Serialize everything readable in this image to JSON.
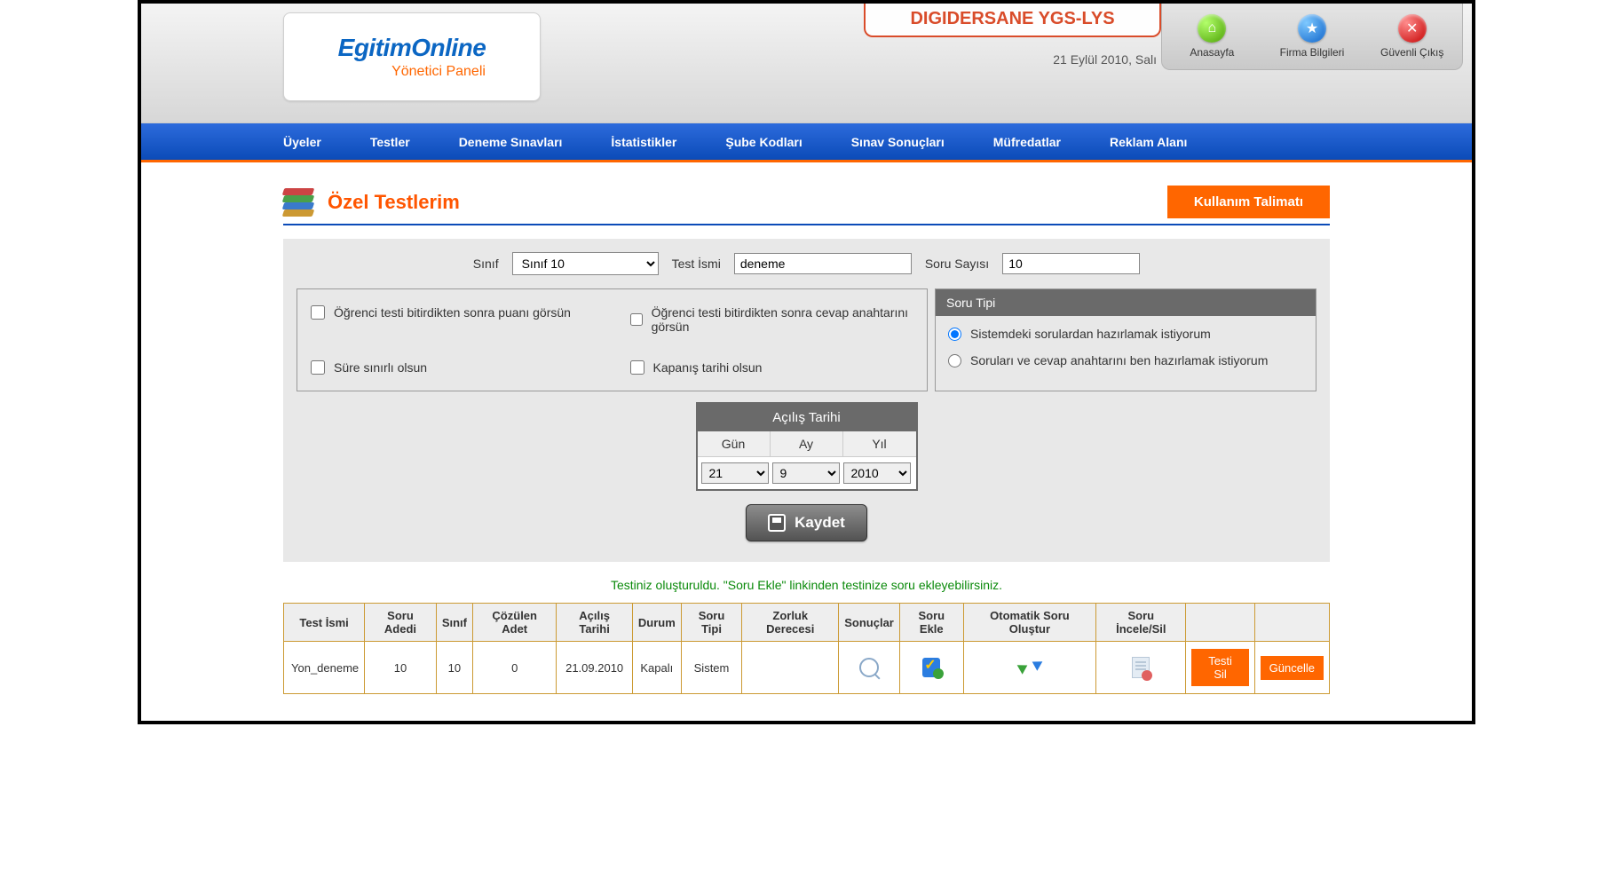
{
  "logo": {
    "main": "EgitimOnline",
    "sub": "Yönetici Paneli"
  },
  "header": {
    "company": "DIGIDERSANE YGS-LYS",
    "date": "21 Eylül 2010, Salı",
    "quick": [
      {
        "label": "Anasayfa",
        "icon": "home"
      },
      {
        "label": "Firma Bilgileri",
        "icon": "star"
      },
      {
        "label": "Güvenli Çıkış",
        "icon": "exit"
      }
    ]
  },
  "nav": [
    "Üyeler",
    "Testler",
    "Deneme Sınavları",
    "İstatistikler",
    "Şube Kodları",
    "Sınav Sonuçları",
    "Müfredatlar",
    "Reklam Alanı"
  ],
  "page": {
    "title": "Özel Testlerim",
    "usage_btn": "Kullanım Talimatı"
  },
  "form": {
    "sinif_label": "Sınıf",
    "sinif_value": "Sınıf 10",
    "test_label": "Test İsmi",
    "test_value": "deneme",
    "count_label": "Soru Sayısı",
    "count_value": "10",
    "opts": {
      "show_score": "Öğrenci testi bitirdikten sonra puanı görsün",
      "show_key": "Öğrenci testi bitirdikten sonra cevap anahtarını görsün",
      "time_limit": "Süre sınırlı olsun",
      "close_date": "Kapanış tarihi olsun"
    },
    "qtype": {
      "title": "Soru Tipi",
      "opt1": "Sistemdeki sorulardan hazırlamak istiyorum",
      "opt2": "Soruları ve cevap anahtarını ben hazırlamak istiyorum"
    },
    "open_date": {
      "title": "Açılış Tarihi",
      "day_label": "Gün",
      "month_label": "Ay",
      "year_label": "Yıl",
      "day": "21",
      "month": "9",
      "year": "2010"
    },
    "save": "Kaydet"
  },
  "success": "Testiniz oluşturuldu. \"Soru Ekle\" linkinden testinize soru ekleyebilirsiniz.",
  "table": {
    "headers": [
      "Test İsmi",
      "Soru Adedi",
      "Sınıf",
      "Çözülen Adet",
      "Açılış Tarihi",
      "Durum",
      "Soru Tipi",
      "Zorluk Derecesi",
      "Sonuçlar",
      "Soru Ekle",
      "Otomatik Soru Oluştur",
      "Soru İncele/Sil",
      "",
      ""
    ],
    "row": {
      "name": "Yon_deneme",
      "count": "10",
      "grade": "10",
      "solved": "0",
      "date": "21.09.2010",
      "status": "Kapalı",
      "qtype": "Sistem",
      "difficulty": "",
      "delete": "Testi Sil",
      "update": "Güncelle"
    }
  }
}
